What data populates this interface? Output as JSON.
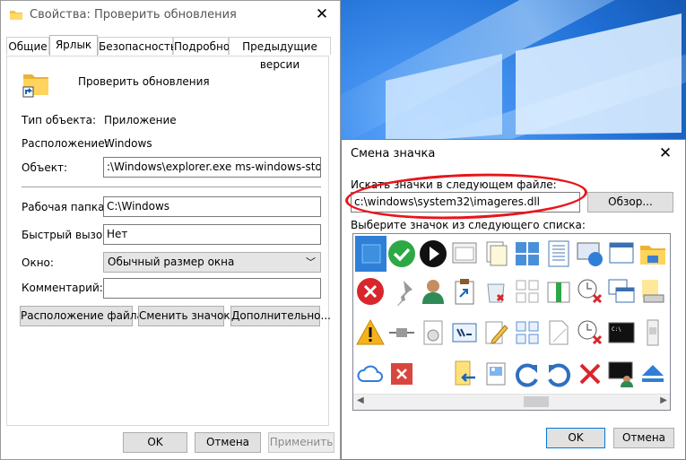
{
  "properties_window": {
    "title": "Свойства: Проверить обновления",
    "tabs": [
      "Общие",
      "Ярлык",
      "Безопасность",
      "Подробно",
      "Предыдущие версии"
    ],
    "active_tab": "Ярлык",
    "shortcut_name": "Проверить обновления",
    "rows": {
      "type_label": "Тип объекта:",
      "type_value": "Приложение",
      "location_label": "Расположение:",
      "location_value": "Windows",
      "target_label": "Объект:",
      "target_value": ":\\Windows\\explorer.exe ms-windows-store:update",
      "workdir_label": "Рабочая папка:",
      "workdir_value": "C:\\Windows",
      "hotkey_label": "Быстрый вызов:",
      "hotkey_value": "Нет",
      "window_label": "Окно:",
      "window_value": "Обычный размер окна",
      "comment_label": "Комментарий:",
      "comment_value": ""
    },
    "buttons": {
      "open_location": "Расположение файла",
      "change_icon": "Сменить значок...",
      "advanced": "Дополнительно...",
      "ok": "OK",
      "cancel": "Отмена",
      "apply": "Применить"
    }
  },
  "change_icon_dialog": {
    "title": "Смена значка",
    "search_label": "Искать значки в следующем файле:",
    "file_path": "c:\\windows\\system32\\imageres.dll",
    "browse_button": "Обзор...",
    "list_label": "Выберите значок из следующего списка:",
    "ok": "OK",
    "cancel": "Отмена",
    "icons": [
      [
        "blank-blue-selected-icon",
        "green-check-icon",
        "play-icon",
        "window-frame-icon",
        "documents-icon",
        "tiles-icon",
        "document-columns-icon",
        "globe-monitor-icon",
        "window-icon",
        "folder-icon"
      ],
      [
        "red-x-circle-icon",
        "pin-icon",
        "user-icon",
        "clipboard-arrow-icon",
        "recycle-bin-icon",
        "grid-icon",
        "green-bar-icon",
        "clock-error-icon",
        "windows-stack-icon",
        "folder-drive-icon"
      ],
      [
        "warning-icon",
        "connector-icon",
        "disc-page-icon",
        "run-window-icon",
        "pencil-icon",
        "grid-small-icon",
        "blank-page-icon",
        "clock-x-icon",
        "console-icon",
        "scrollbar-icon"
      ],
      [
        "cloud-icon",
        "red-x-square-icon",
        "empty-icon",
        "folder-arrow-icon",
        "image-doc-icon",
        "redo-icon",
        "undo-icon",
        "red-x-icon",
        "console-user-icon",
        "eject-icon"
      ]
    ]
  }
}
